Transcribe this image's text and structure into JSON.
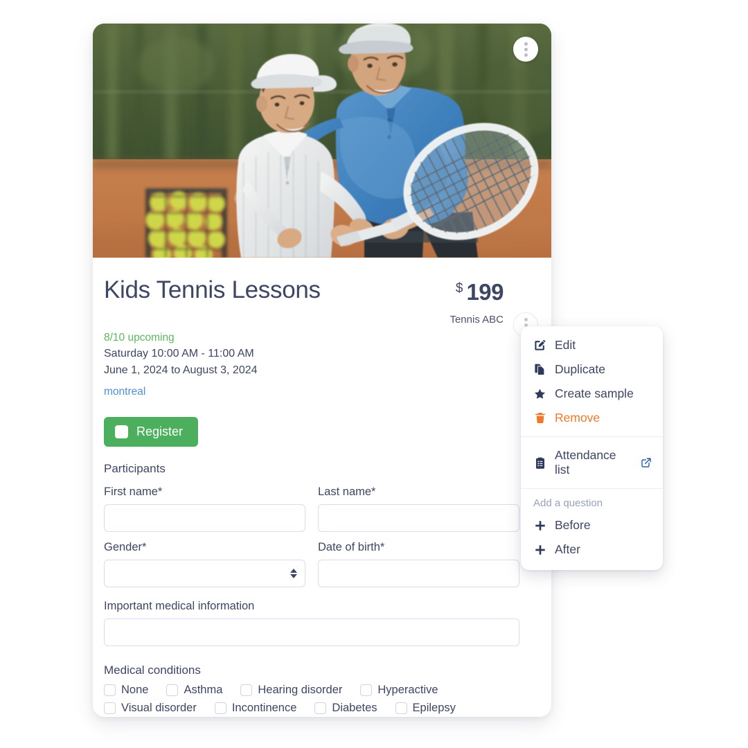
{
  "card": {
    "hero": {
      "alt": "tennis-coach-teaching-boy",
      "menu_icon": "kebab-menu-icon"
    },
    "title": "Kids Tennis Lessons",
    "price": {
      "currency": "$",
      "amount": "199"
    },
    "organization": "Tennis ABC",
    "meta": {
      "upcoming": "8/10 upcoming",
      "schedule": "Saturday 10:00 AM - 11:00 AM",
      "dates": "June 1, 2024 to August 3, 2024",
      "location": "montreal"
    },
    "register_button": "Register",
    "participants_label": "Participants",
    "fields": {
      "first_name": {
        "label": "First name*",
        "value": ""
      },
      "last_name": {
        "label": "Last name*",
        "value": ""
      },
      "gender": {
        "label": "Gender*",
        "value": ""
      },
      "date_of_birth": {
        "label": "Date of birth*",
        "value": ""
      },
      "medical_info": {
        "label": "Important medical information",
        "value": ""
      }
    },
    "medical_conditions": {
      "title": "Medical conditions",
      "row1": [
        "None",
        "Asthma",
        "Hearing disorder",
        "Hyperactive"
      ],
      "row2": [
        "Visual disorder",
        "Incontinence",
        "Diabetes",
        "Epilepsy"
      ]
    }
  },
  "menu": {
    "items": [
      {
        "label": "Edit",
        "icon": "edit-pencil-icon"
      },
      {
        "label": "Duplicate",
        "icon": "copy-icon"
      },
      {
        "label": "Create sample",
        "icon": "star-icon"
      },
      {
        "label": "Remove",
        "icon": "trash-icon"
      }
    ],
    "attendance": {
      "label": "Attendance list",
      "icon": "clipboard-icon",
      "external_icon": "external-link-icon"
    },
    "add_question_label": "Add a question",
    "add_items": [
      {
        "label": "Before",
        "icon": "plus-icon"
      },
      {
        "label": "After",
        "icon": "plus-icon"
      }
    ]
  },
  "colors": {
    "text_dark": "#3d4662",
    "green": "#5cb85c",
    "button_green": "#4caf5d",
    "link_blue": "#4a90d9",
    "danger_orange": "#f0782a",
    "muted": "#98a0bb",
    "border": "#d9dcea"
  }
}
